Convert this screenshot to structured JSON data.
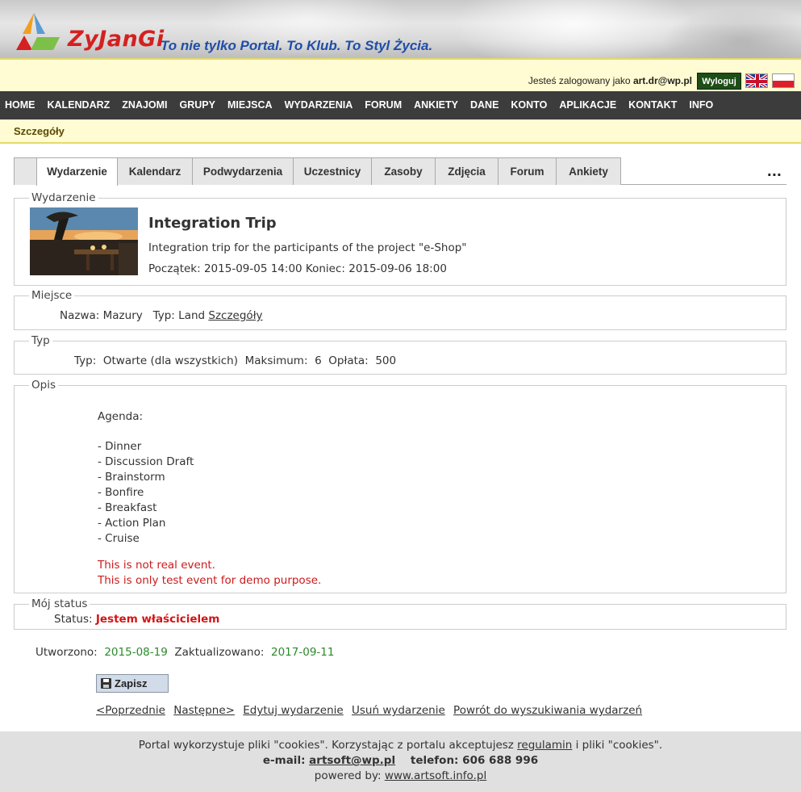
{
  "header": {
    "logo_text": "ZyJanGi",
    "tagline": "To nie tylko Portal. To Klub. To Styl Życia."
  },
  "login": {
    "prefix": "Jesteś zalogowany jako",
    "user": "art.dr@wp.pl",
    "logout_label": "Wyloguj",
    "flags": [
      "flag-uk-icon",
      "flag-pl-icon"
    ]
  },
  "nav": [
    "HOME",
    "KALENDARZ",
    "ZNAJOMI",
    "GRUPY",
    "MIEJSCA",
    "WYDARZENIA",
    "FORUM",
    "ANKIETY",
    "DANE",
    "KONTO",
    "APLIKACJE",
    "KONTAKT",
    "INFO"
  ],
  "subheader": "Szczegóły",
  "tabs": [
    "Wydarzenie",
    "Kalendarz",
    "Podwydarzenia",
    "Uczestnicy",
    "Zasoby",
    "Zdjęcia",
    "Forum",
    "Ankiety"
  ],
  "tab_more": "...",
  "event": {
    "legend": "Wydarzenie",
    "title": "Integration Trip",
    "description": "Integration trip for the participants of the project \"e-Shop\"",
    "start_label": "Początek:",
    "start": "2015-09-05 14:00",
    "end_label": "Koniec:",
    "end": "2015-09-06 18:00"
  },
  "place": {
    "legend": "Miejsce",
    "name_label": "Nazwa:",
    "name": "Mazury",
    "type_label": "Typ:",
    "type": "Land",
    "details_link": "Szczegóły"
  },
  "type": {
    "legend": "Typ",
    "type_label": "Typ:",
    "type": "Otwarte (dla wszystkich)",
    "max_label": "Maksimum:",
    "max": "6",
    "fee_label": "Opłata:",
    "fee": "500"
  },
  "description": {
    "legend": "Opis",
    "heading": "Agenda:",
    "items": [
      "- Dinner",
      "- Discussion Draft",
      "- Brainstorm",
      "- Bonfire",
      "- Breakfast",
      "- Action Plan",
      "- Cruise"
    ],
    "note1": "This is not real event.",
    "note2": "This is only test event for demo purpose."
  },
  "status": {
    "legend": "Mój status",
    "label": "Status:",
    "value": "Jestem właścicielem"
  },
  "meta": {
    "created_label": "Utworzono:",
    "created": "2015-08-19",
    "updated_label": "Zaktualizowano:",
    "updated": "2017-09-11"
  },
  "save_label": "Zapisz",
  "links": [
    "<Poprzednie",
    "Następne>",
    "Edytuj wydarzenie",
    "Usuń wydarzenie",
    "Powrót do wyszukiwania wydarzeń"
  ],
  "footer": {
    "cookies_text": "Portal wykorzystuje pliki \"cookies\". Korzystając z portalu akceptujesz",
    "cookies_link": "regulamin",
    "cookies_tail": "i pliki \"cookies\".",
    "email_label": "e-mail:",
    "email": "artsoft@wp.pl",
    "phone_label": "telefon:",
    "phone": "606 688 996",
    "powered_label": "powered by:",
    "powered_link": "www.artsoft.info.pl"
  }
}
